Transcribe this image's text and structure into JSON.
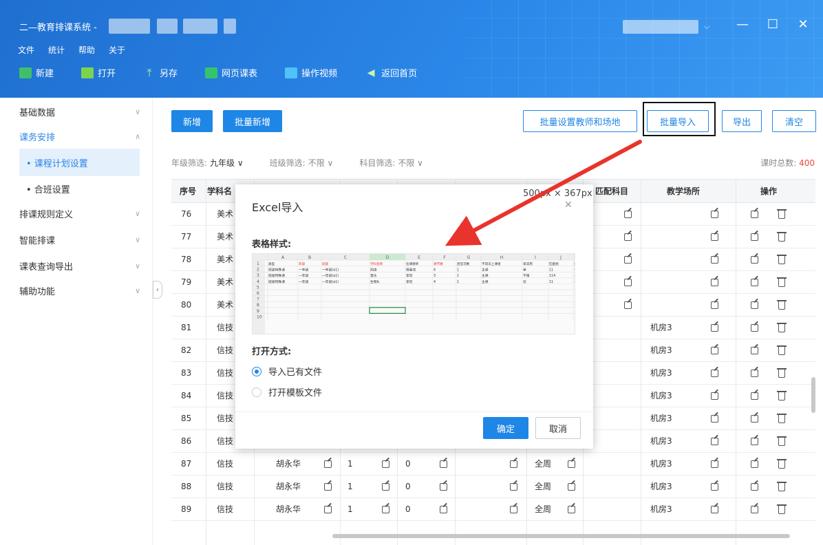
{
  "window": {
    "title": "二—教育排课系统 -",
    "minimize": "—",
    "maximize": "☐",
    "close": "✕",
    "user_chevron": "⌵"
  },
  "menu": [
    "文件",
    "统计",
    "帮助",
    "关于"
  ],
  "toolbar": [
    {
      "label": "新建",
      "icon": "new-doc-icon"
    },
    {
      "label": "打开",
      "icon": "folder-icon"
    },
    {
      "label": "另存",
      "icon": "save-as-icon"
    },
    {
      "label": "网页课表",
      "icon": "web-table-icon"
    },
    {
      "label": "操作视频",
      "icon": "video-icon"
    },
    {
      "label": "返回首页",
      "icon": "home-icon"
    }
  ],
  "sidebar": {
    "items": [
      {
        "label": "基础数据",
        "chev": "∨"
      },
      {
        "label": "课务安排",
        "chev": "∧"
      },
      {
        "label": "排课规则定义",
        "chev": "∨"
      },
      {
        "label": "智能排课",
        "chev": "∨"
      },
      {
        "label": "课表查询导出",
        "chev": "∨"
      },
      {
        "label": "辅助功能",
        "chev": "∨"
      }
    ],
    "sub": [
      {
        "label": "• 课程计划设置"
      },
      {
        "label": "• 合班设置"
      }
    ],
    "collapse": "‹"
  },
  "actions": {
    "add": "新增",
    "batch_add": "批量新增",
    "batch_set": "批量设置教师和场地",
    "batch_import": "批量导入",
    "export": "导出",
    "clear": "清空"
  },
  "filters": {
    "grade_label": "年级筛选:",
    "grade_value": "九年级 ∨",
    "class_label": "班级筛选:",
    "class_value": "不限 ∨",
    "subject_label": "科目筛选:",
    "subject_value": "不限 ∨",
    "total_label": "课时总数:",
    "total_value": "400"
  },
  "table": {
    "headers": {
      "no": "序号",
      "subject": "学科名",
      "match": "匹配科目",
      "venue": "教学场所",
      "ops": "操作"
    },
    "rows": [
      {
        "no": "76",
        "subject": "美术",
        "teacher": "",
        "a": "",
        "b": "",
        "c": "",
        "venue": ""
      },
      {
        "no": "77",
        "subject": "美术",
        "teacher": "",
        "a": "",
        "b": "",
        "c": "",
        "venue": ""
      },
      {
        "no": "78",
        "subject": "美术",
        "teacher": "",
        "a": "",
        "b": "",
        "c": "",
        "venue": ""
      },
      {
        "no": "79",
        "subject": "美术",
        "teacher": "",
        "a": "",
        "b": "",
        "c": "",
        "venue": ""
      },
      {
        "no": "80",
        "subject": "美术",
        "teacher": "",
        "a": "",
        "b": "",
        "c": "",
        "venue": ""
      },
      {
        "no": "81",
        "subject": "信技",
        "teacher": "",
        "a": "",
        "b": "",
        "c": "",
        "venue": "机房3"
      },
      {
        "no": "82",
        "subject": "信技",
        "teacher": "",
        "a": "",
        "b": "",
        "c": "",
        "venue": "机房3"
      },
      {
        "no": "83",
        "subject": "信技",
        "teacher": "",
        "a": "",
        "b": "",
        "c": "",
        "venue": "机房3"
      },
      {
        "no": "84",
        "subject": "信技",
        "teacher": "",
        "a": "",
        "b": "",
        "c": "",
        "venue": "机房3"
      },
      {
        "no": "85",
        "subject": "信技",
        "teacher": "",
        "a": "",
        "b": "",
        "c": "",
        "venue": "机房3"
      },
      {
        "no": "86",
        "subject": "信技",
        "teacher": "",
        "a": "",
        "b": "",
        "c": "",
        "venue": "机房3"
      },
      {
        "no": "87",
        "subject": "信技",
        "teacher": "胡永华",
        "a": "1",
        "b": "0",
        "c": "全周",
        "venue": "机房3"
      },
      {
        "no": "88",
        "subject": "信技",
        "teacher": "胡永华",
        "a": "1",
        "b": "0",
        "c": "全周",
        "venue": "机房3"
      },
      {
        "no": "89",
        "subject": "信技",
        "teacher": "胡永华",
        "a": "1",
        "b": "0",
        "c": "全周",
        "venue": "机房3"
      }
    ]
  },
  "modal": {
    "title": "Excel导入",
    "size": "500px × 367px",
    "close": "✕",
    "table_style_label": "表格样式:",
    "open_mode_label": "打开方式:",
    "opt_existing": "导入已有文件",
    "opt_template": "打开模板文件",
    "ok": "确定",
    "cancel": "取消",
    "sheet": {
      "cols": [
        "A",
        "B",
        "C",
        "D",
        "E",
        "F",
        "G",
        "H",
        "I",
        "J"
      ],
      "header_row": [
        "类型",
        "年级",
        "班级",
        "学科名称",
        "任课教师",
        "课节数",
        "连堂次数",
        "不同天上课组",
        "单双周",
        "匹配组",
        "教学场所"
      ],
      "rows": [
        [
          "班级特殊课",
          "一年级",
          "一年级(a1)",
          "阅读",
          "杨春花",
          "4",
          "1",
          "主课",
          "单",
          "11",
          "一楼"
        ],
        [
          "班级特殊课",
          "一年级",
          "一年级(a1)",
          "音乐",
          "李欢",
          "3",
          "1",
          "主课",
          "不限",
          "114",
          "一楼"
        ],
        [
          "班级特殊课",
          "一年级",
          "一年级(a1)",
          "生物&",
          "李欢",
          "4",
          "1",
          "主课",
          "双",
          "11",
          "一楼"
        ]
      ],
      "row_numbers": [
        "1",
        "2",
        "3",
        "4",
        "5",
        "6",
        "7",
        "8",
        "9",
        "10"
      ]
    }
  },
  "colors": {
    "primary": "#1e86e6",
    "header": "#2a86e8",
    "total": "#e84b3c",
    "arrow": "#e8342c"
  }
}
